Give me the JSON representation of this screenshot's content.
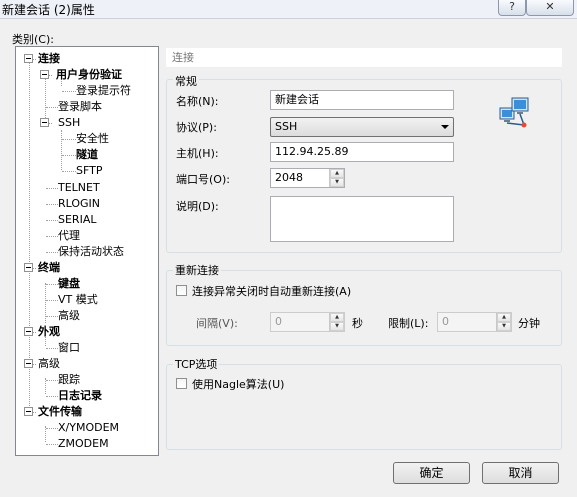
{
  "window": {
    "title": "新建会话 (2)属性",
    "help": "?",
    "close": "✕"
  },
  "category_label": "类别(C):",
  "tree": {
    "connection": "连接",
    "user_auth": "用户身份验证",
    "login_prompt": "登录提示符",
    "login_script": "登录脚本",
    "ssh": "SSH",
    "security": "安全性",
    "tunnel": "隧道",
    "sftp": "SFTP",
    "telnet": "TELNET",
    "rlogin": "RLOGIN",
    "serial": "SERIAL",
    "proxy": "代理",
    "keepalive": "保持活动状态",
    "terminal": "终端",
    "keyboard": "键盘",
    "vt_mode": "VT 模式",
    "terminal_advanced": "高级",
    "appearance": "外观",
    "window": "窗口",
    "advanced": "高级",
    "trace": "跟踪",
    "logging": "日志记录",
    "file_transfer": "文件传输",
    "xymodem": "X/YMODEM",
    "zmodem": "ZMODEM"
  },
  "panel": {
    "header": "连接",
    "general": {
      "title": "常规",
      "name_label": "名称(N):",
      "name_value": "新建会话",
      "protocol_label": "协议(P):",
      "protocol_value": "SSH",
      "host_label": "主机(H):",
      "host_value": "112.94.25.89",
      "port_label": "端口号(O):",
      "port_value": "2048",
      "desc_label": "说明(D):",
      "desc_value": ""
    },
    "reconnect": {
      "title": "重新连接",
      "auto_label": "连接异常关闭时自动重新连接(A)",
      "auto_checked": false,
      "interval_label": "间隔(V):",
      "interval_value": "0",
      "interval_unit": "秒",
      "limit_label": "限制(L):",
      "limit_value": "0",
      "limit_unit": "分钟"
    },
    "tcp": {
      "title": "TCP选项",
      "nagle_label": "使用Nagle算法(U)",
      "nagle_checked": false
    }
  },
  "buttons": {
    "ok": "确定",
    "cancel": "取消"
  },
  "icons": {
    "session": "network-computers-icon"
  }
}
